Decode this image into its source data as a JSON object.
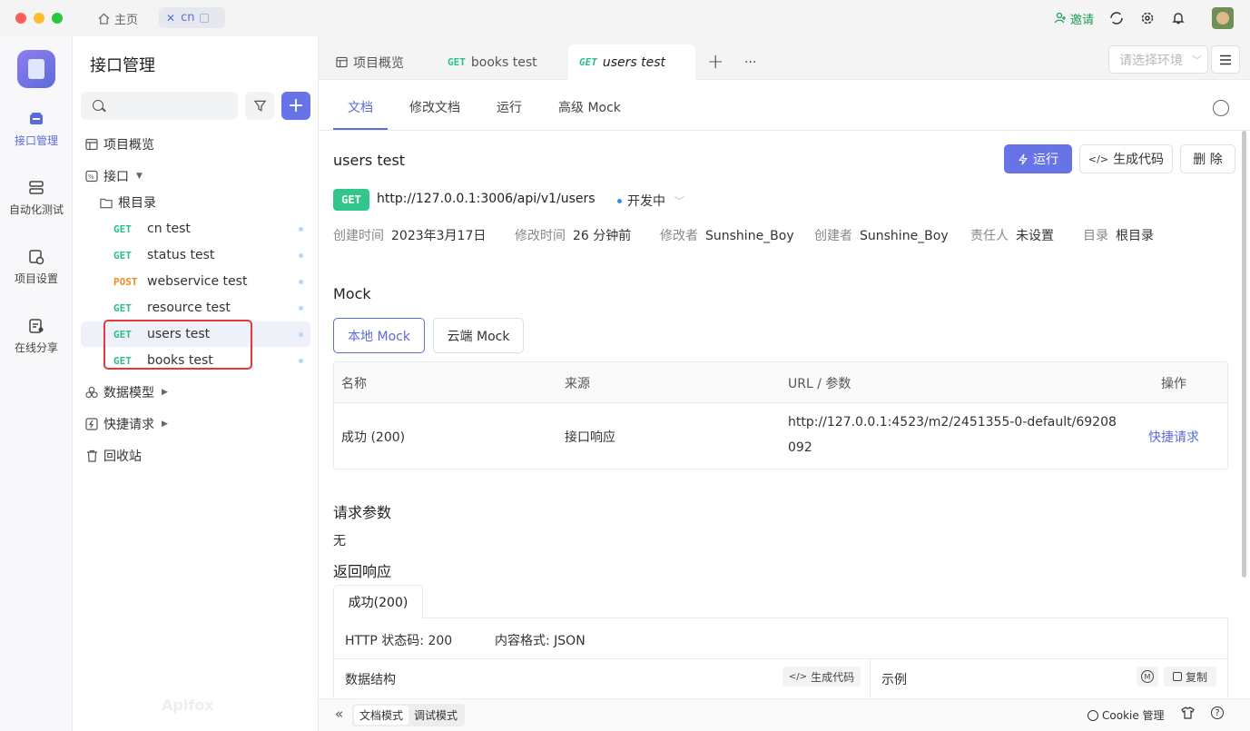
{
  "titlebar": {
    "home_tab": "主页",
    "doc_tab": "cn",
    "invite": "邀请"
  },
  "rail": {
    "items": [
      {
        "label": "接口管理",
        "icon": "api-management-icon"
      },
      {
        "label": "自动化测试",
        "icon": "automation-test-icon"
      },
      {
        "label": "项目设置",
        "icon": "project-settings-icon"
      },
      {
        "label": "在线分享",
        "icon": "online-share-icon"
      }
    ]
  },
  "sidebar": {
    "title": "接口管理",
    "search_placeholder": "",
    "overview": "项目概览",
    "api_group": "接口",
    "root_folder": "根目录",
    "apis": [
      {
        "method": "GET",
        "name": "cn test"
      },
      {
        "method": "GET",
        "name": "status test"
      },
      {
        "method": "POST",
        "name": "webservice test"
      },
      {
        "method": "GET",
        "name": "resource test"
      },
      {
        "method": "GET",
        "name": "users test"
      },
      {
        "method": "GET",
        "name": "books test"
      }
    ],
    "data_models": "数据模型",
    "quick_request": "快捷请求",
    "recycle_bin": "回收站",
    "watermark": "Apifox"
  },
  "tabs": {
    "overview": "项目概览",
    "books_method": "GET",
    "books": "books test",
    "users_method": "GET",
    "users": "users test",
    "more": "···",
    "env_placeholder": "请选择环境"
  },
  "subtabs": {
    "doc": "文档",
    "edit": "修改文档",
    "run": "运行",
    "mock": "高级 Mock"
  },
  "api": {
    "name": "users test",
    "run_button": "运行",
    "gen_code_button": "生成代码",
    "delete_button": "删 除",
    "method": "GET",
    "url": "http://127.0.0.1:3006/api/v1/users",
    "status": "开发中",
    "meta": [
      {
        "label": "创建时间",
        "value": "2023年3月17日"
      },
      {
        "label": "修改时间",
        "value": "26 分钟前"
      },
      {
        "label": "修改者",
        "value": "Sunshine_Boy"
      },
      {
        "label": "创建者",
        "value": "Sunshine_Boy"
      },
      {
        "label": "责任人",
        "value": "未设置"
      },
      {
        "label": "目录",
        "value": "根目录"
      }
    ]
  },
  "mock": {
    "title": "Mock",
    "local_tab": "本地 Mock",
    "cloud_tab": "云端 Mock",
    "columns": [
      "名称",
      "来源",
      "URL / 参数",
      "操作"
    ],
    "row": {
      "name": "成功 (200)",
      "source": "接口响应",
      "url_line1": "http://127.0.0.1:4523/m2/2451355-0-default/69208",
      "url_line2": "092",
      "action": "快捷请求"
    }
  },
  "request": {
    "title": "请求参数",
    "value": "无"
  },
  "response": {
    "title": "返回响应",
    "tab": "成功(200)",
    "status_code": "HTTP 状态码: 200",
    "content_type": "内容格式: JSON",
    "data_structure": "数据结构",
    "gen_code": "生成代码",
    "example": "示例",
    "copy": "复制"
  },
  "bottombar": {
    "doc_mode": "文档模式",
    "debug_mode": "调试模式",
    "cookie": "Cookie 管理"
  },
  "colors": {
    "accent": "#5b6cd9",
    "get": "#2ebd86",
    "post": "#f08b24"
  }
}
